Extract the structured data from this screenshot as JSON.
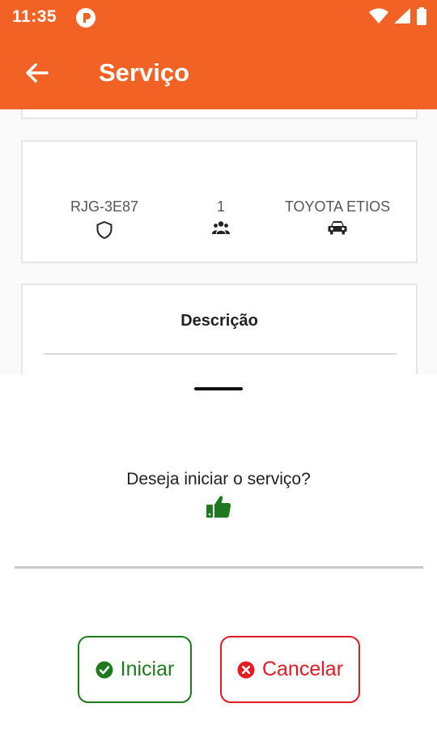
{
  "status_bar": {
    "time": "11:35"
  },
  "app_bar": {
    "title": "Serviço"
  },
  "vehicle": {
    "plate": "RJG-3E87",
    "passengers": "1",
    "model": "TOYOTA ETIOS"
  },
  "description": {
    "title": "Descrição"
  },
  "sheet": {
    "prompt": "Deseja iniciar o serviço?",
    "start_label": "Iniciar",
    "cancel_label": "Cancelar"
  },
  "colors": {
    "brand": "#f26225",
    "confirm": "#1f7a1f",
    "cancel": "#e31b23"
  },
  "icons": [
    "back-arrow-icon",
    "shield-icon",
    "users-icon",
    "car-icon",
    "thumbs-up-icon",
    "check-circle-icon",
    "x-circle-icon"
  ]
}
